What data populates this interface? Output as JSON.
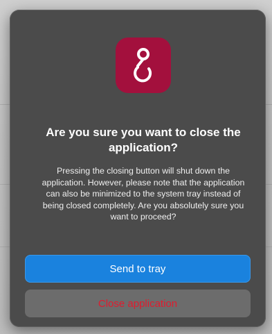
{
  "dialog": {
    "icon_name": "app-logo-icon",
    "icon_color": "#a3103d",
    "title": "Are you sure you want to close the application?",
    "message": "Pressing the closing button will shut down the application. However, please note that the application can also be minimized to the system tray instead of being closed completely. Are you absolutely sure you want to proceed?",
    "primary_button": "Send to tray",
    "secondary_button": "Close application"
  },
  "colors": {
    "dialog_background": "#4b4b4b",
    "primary_button": "#1a82de",
    "danger_text": "#e01b2e"
  }
}
